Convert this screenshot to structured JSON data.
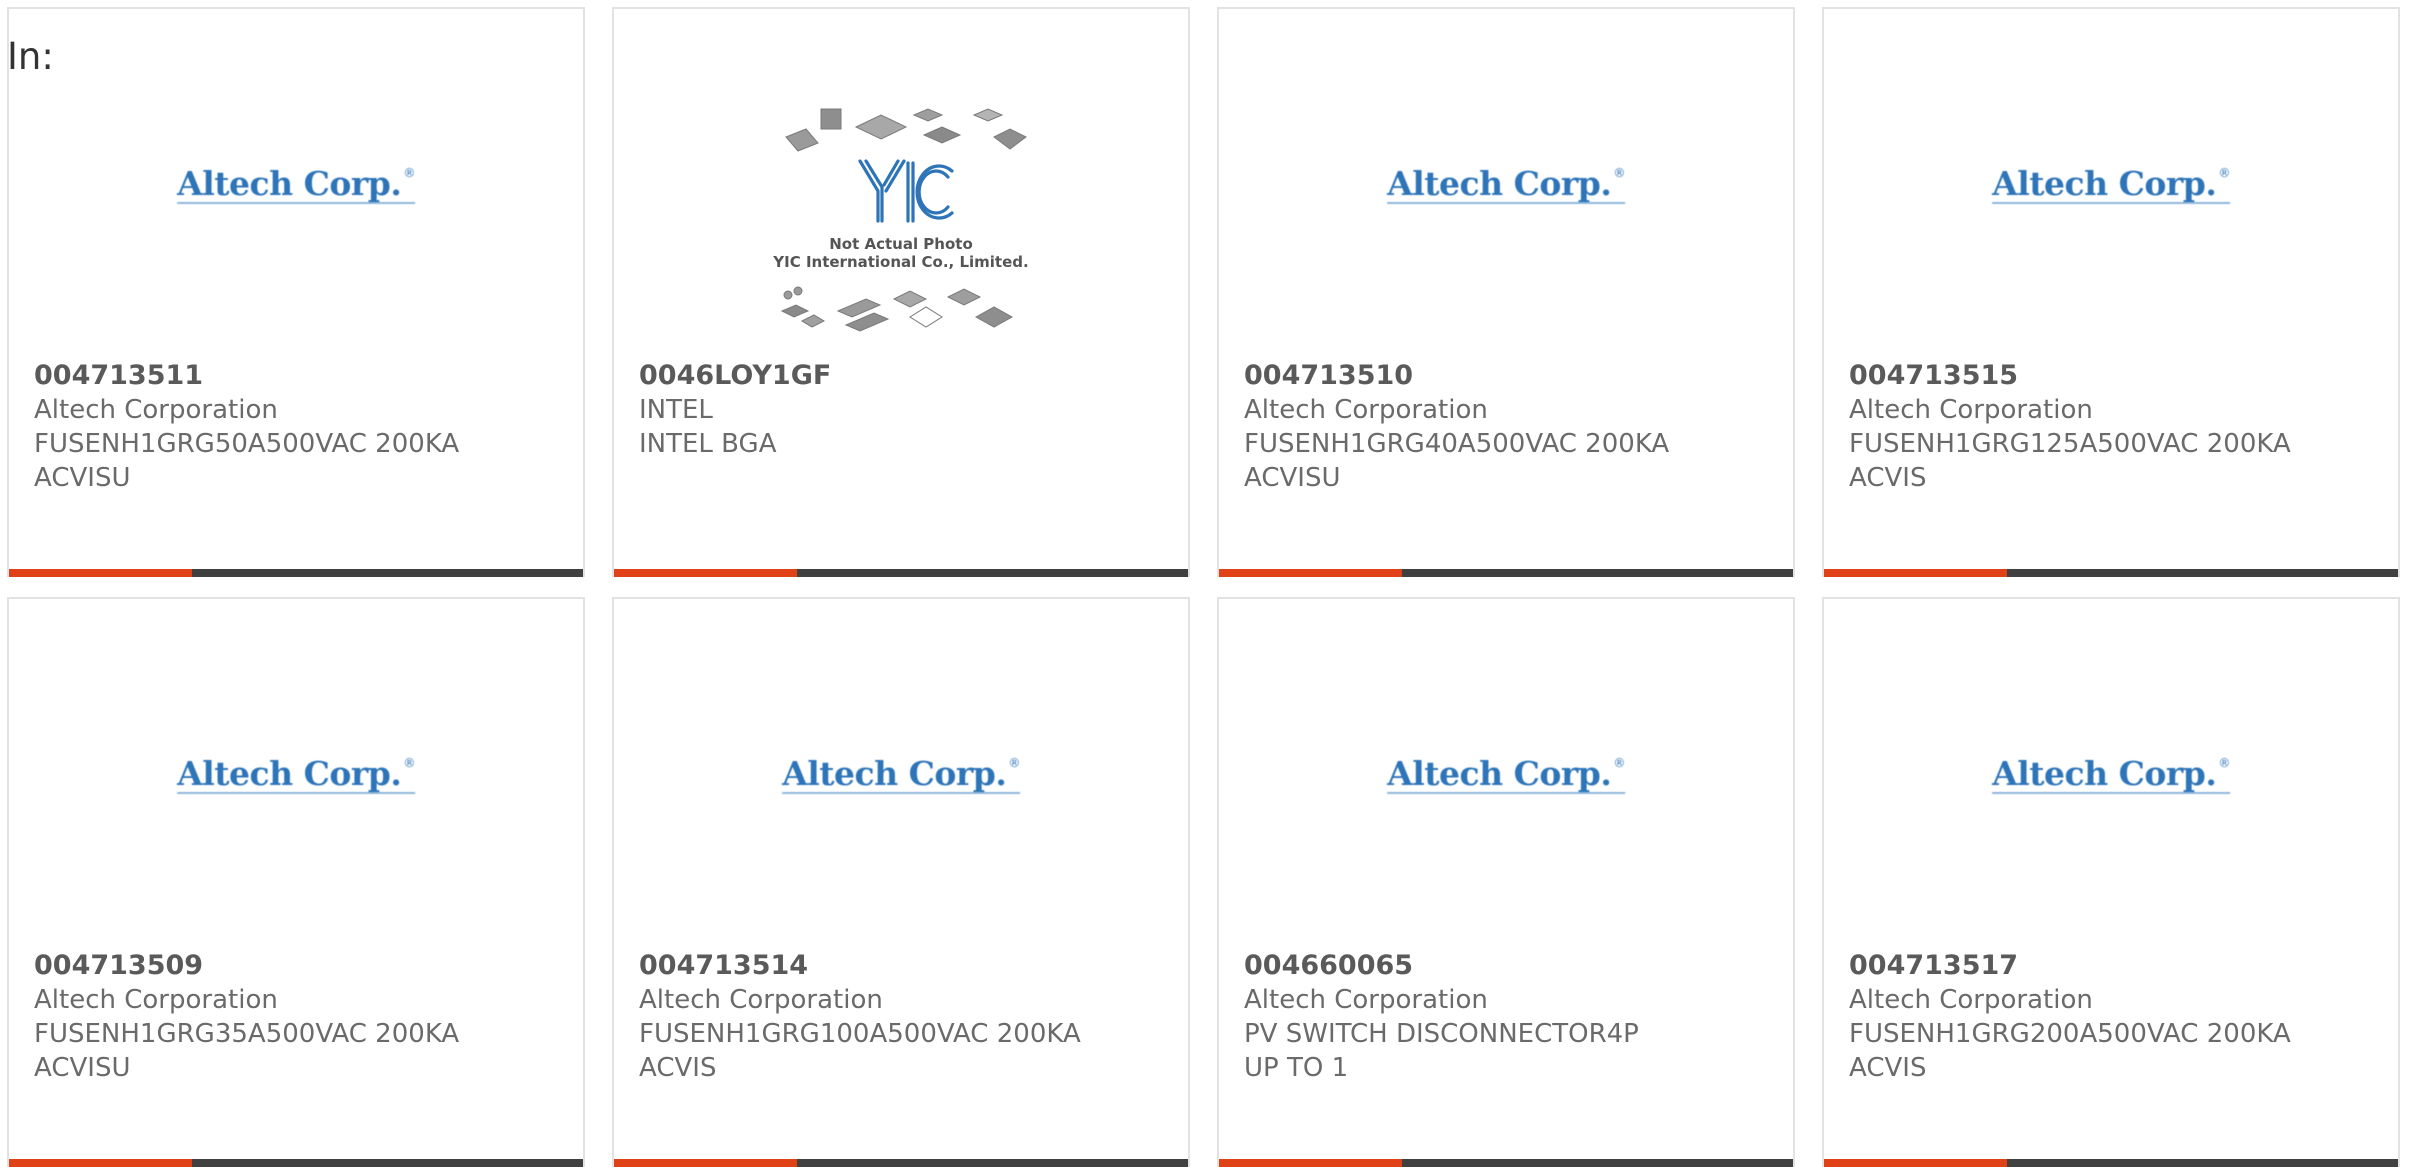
{
  "header": {
    "in_label": "In:"
  },
  "colors": {
    "accent": "#e04116",
    "bar": "#404040",
    "logo": "#2d74b8"
  },
  "cards": [
    {
      "image": "altech-logo",
      "logo_text": "Altech Corp.",
      "part": "004713511",
      "manufacturer": "Altech Corporation",
      "desc1": "FUSENH1GRG50A500VAC 200KA",
      "desc2": "ACVISU"
    },
    {
      "image": "yic-placeholder",
      "photo_note": "Not Actual Photo",
      "photo_company": "YIC International Co., Limited.",
      "part": "0046LOY1GF",
      "manufacturer": "INTEL",
      "desc1": "INTEL BGA",
      "desc2": ""
    },
    {
      "image": "altech-logo",
      "logo_text": "Altech Corp.",
      "part": "004713510",
      "manufacturer": "Altech Corporation",
      "desc1": "FUSENH1GRG40A500VAC 200KA",
      "desc2": "ACVISU"
    },
    {
      "image": "altech-logo",
      "logo_text": "Altech Corp.",
      "part": "004713515",
      "manufacturer": "Altech Corporation",
      "desc1": "FUSENH1GRG125A500VAC 200KA",
      "desc2": "ACVIS"
    },
    {
      "image": "altech-logo",
      "logo_text": "Altech Corp.",
      "part": "004713509",
      "manufacturer": "Altech Corporation",
      "desc1": "FUSENH1GRG35A500VAC 200KA",
      "desc2": "ACVISU"
    },
    {
      "image": "altech-logo",
      "logo_text": "Altech Corp.",
      "part": "004713514",
      "manufacturer": "Altech Corporation",
      "desc1": "FUSENH1GRG100A500VAC 200KA",
      "desc2": "ACVIS"
    },
    {
      "image": "altech-logo",
      "logo_text": "Altech Corp.",
      "part": "004660065",
      "manufacturer": "Altech Corporation",
      "desc1": "PV SWITCH DISCONNECTOR4P",
      "desc2": "UP TO 1"
    },
    {
      "image": "altech-logo",
      "logo_text": "Altech Corp.",
      "part": "004713517",
      "manufacturer": "Altech Corporation",
      "desc1": "FUSENH1GRG200A500VAC 200KA",
      "desc2": "ACVIS"
    }
  ]
}
